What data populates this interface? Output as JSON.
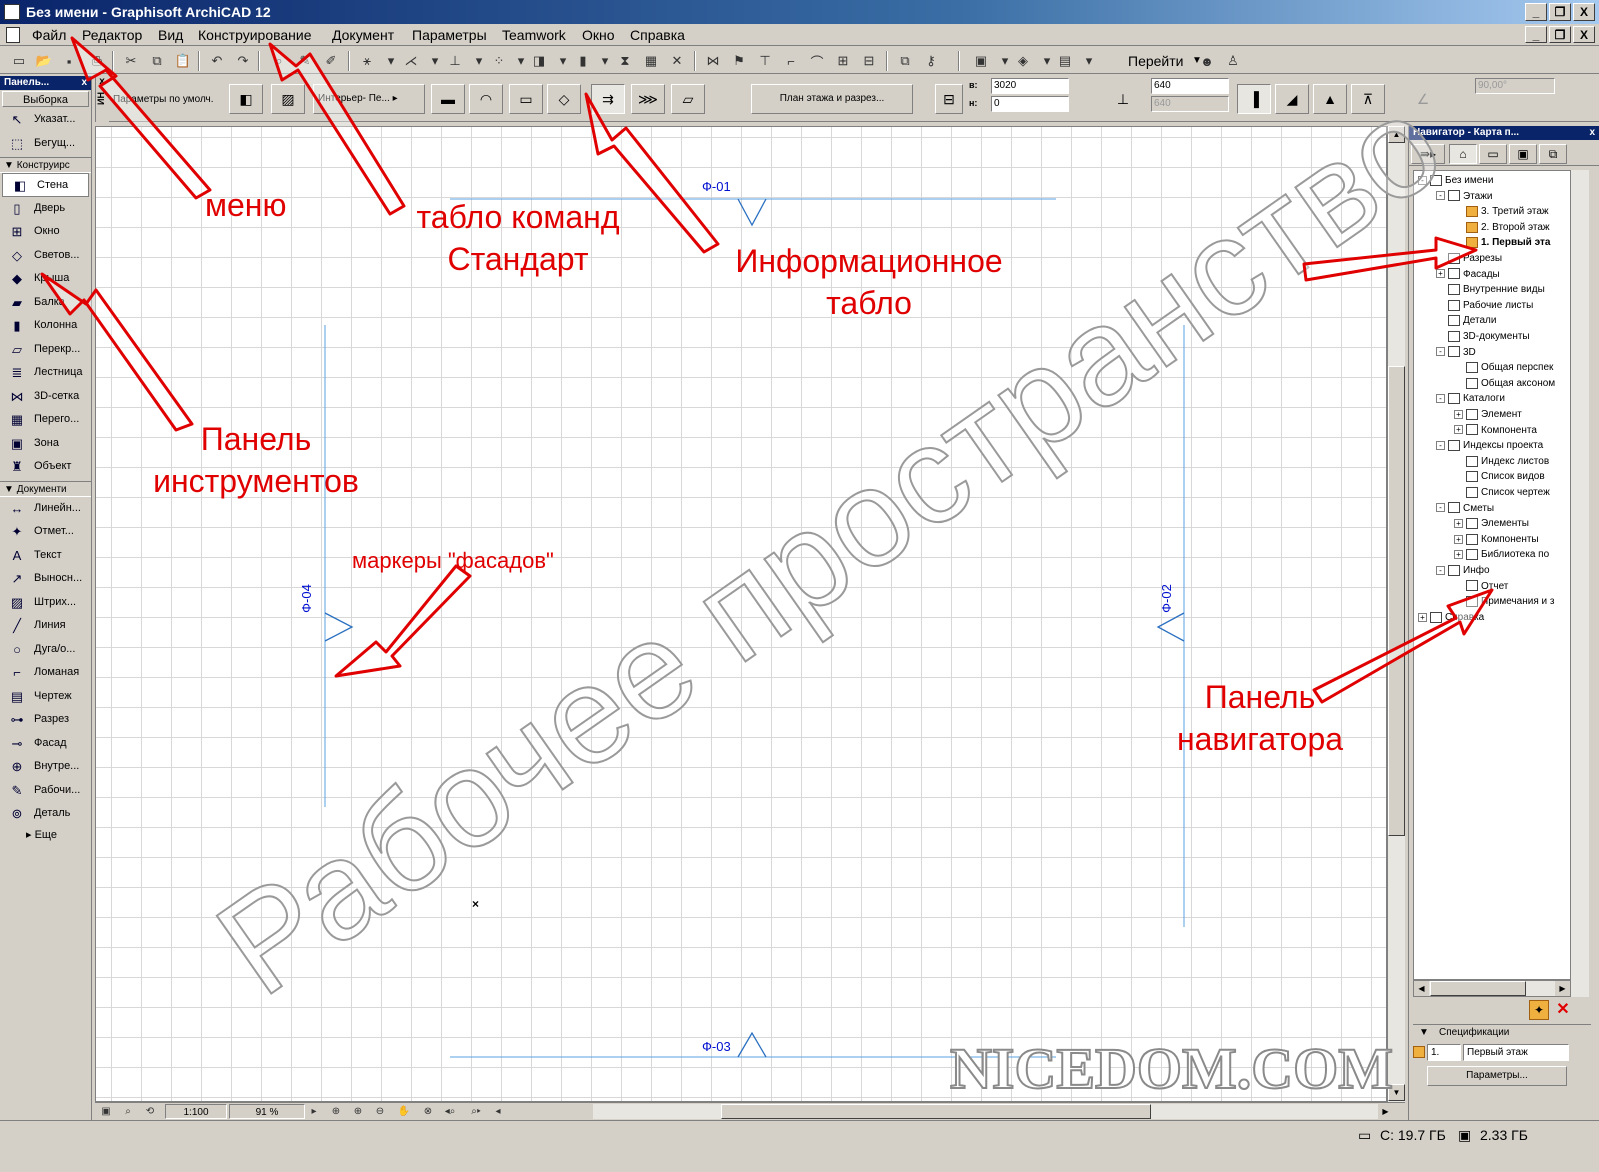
{
  "window": {
    "title": "Без имени - Graphisoft ArchiCAD 12",
    "min": "_",
    "restore": "❐",
    "close": "X"
  },
  "menu": [
    "Файл",
    "Редактор",
    "Вид",
    "Конструирование",
    "Документ",
    "Параметры",
    "Teamwork",
    "Окно",
    "Справка"
  ],
  "toolbar": {
    "goto_label": "Перейти",
    "goto_arrow": "▼"
  },
  "info_box": {
    "vertical_tab": "ИН",
    "close": "x",
    "default_label": "Параметры по умолч.",
    "profile": "Интерьер- Пе...",
    "plan_section": "План этажа и разрез...",
    "top_label": "в:",
    "bottom_label": "н:",
    "top_value": "3020",
    "bottom_value": "0",
    "thickness_value": "640",
    "thickness_value2": "640",
    "angle_value": "90,00°"
  },
  "tool_panel": {
    "title": "Панель...",
    "close": "x",
    "select_label": "Выборка",
    "section_design": "Конструирс",
    "design_items": [
      {
        "label": "Указат...",
        "icon": "arrow-icon"
      },
      {
        "label": "Бегущ...",
        "icon": "marquee-icon"
      }
    ],
    "construct_items": [
      {
        "label": "Стена",
        "icon": "wall-icon"
      },
      {
        "label": "Дверь",
        "icon": "door-icon"
      },
      {
        "label": "Окно",
        "icon": "window-icon"
      },
      {
        "label": "Светов...",
        "icon": "skylight-icon"
      },
      {
        "label": "Крыша",
        "icon": "roof-icon"
      },
      {
        "label": "Балка",
        "icon": "beam-icon"
      },
      {
        "label": "Колонна",
        "icon": "column-icon"
      },
      {
        "label": "Перекр...",
        "icon": "slab-icon"
      },
      {
        "label": "Лестница",
        "icon": "stair-icon"
      },
      {
        "label": "3D-сетка",
        "icon": "mesh-icon"
      },
      {
        "label": "Перего...",
        "icon": "curtain-wall-icon"
      },
      {
        "label": "Зона",
        "icon": "zone-icon"
      },
      {
        "label": "Объект",
        "icon": "object-icon"
      }
    ],
    "section_docs": "Документи",
    "doc_items": [
      {
        "label": "Линейн...",
        "icon": "dimension-icon"
      },
      {
        "label": "Отмет...",
        "icon": "level-dimension-icon"
      },
      {
        "label": "Текст",
        "icon": "text-icon"
      },
      {
        "label": "Выносн...",
        "icon": "label-icon"
      },
      {
        "label": "Штрих...",
        "icon": "fill-icon"
      },
      {
        "label": "Линия",
        "icon": "line-icon"
      },
      {
        "label": "Дуга/о...",
        "icon": "arc-icon"
      },
      {
        "label": "Ломаная",
        "icon": "polyline-icon"
      },
      {
        "label": "Чертеж",
        "icon": "drawing-icon"
      },
      {
        "label": "Разрез",
        "icon": "section-icon"
      },
      {
        "label": "Фасад",
        "icon": "elevation-icon"
      },
      {
        "label": "Внутре...",
        "icon": "interior-elevation-icon"
      },
      {
        "label": "Рабочи...",
        "icon": "worksheet-icon"
      },
      {
        "label": "Деталь",
        "icon": "detail-icon"
      }
    ],
    "more": "Еще"
  },
  "canvas": {
    "markers": {
      "top": "Ф-01",
      "bottom": "Ф-03",
      "left": "Ф-04",
      "right": "Ф-02"
    },
    "watermark": "Рабочее пространство",
    "site_watermark": "NICEDOM.COM",
    "origin": "×"
  },
  "bottom_bar": {
    "scale": "1:100",
    "zoom": "91 %"
  },
  "navigator": {
    "title": "Навигатор - Карта п...",
    "close": "x",
    "tree": [
      {
        "label": "Без имени",
        "level": 0,
        "toggle": "-"
      },
      {
        "label": "Этажи",
        "level": 1,
        "toggle": "-"
      },
      {
        "label": "3. Третий этаж",
        "level": 2,
        "toggle": ""
      },
      {
        "label": "2. Второй этаж",
        "level": 2,
        "toggle": ""
      },
      {
        "label": "1. Первый эта",
        "level": 2,
        "toggle": "",
        "bold": true
      },
      {
        "label": "Разрезы",
        "level": 1,
        "toggle": ""
      },
      {
        "label": "Фасады",
        "level": 1,
        "toggle": "+"
      },
      {
        "label": "Внутренние виды",
        "level": 1,
        "toggle": ""
      },
      {
        "label": "Рабочие листы",
        "level": 1,
        "toggle": ""
      },
      {
        "label": "Детали",
        "level": 1,
        "toggle": ""
      },
      {
        "label": "3D-документы",
        "level": 1,
        "toggle": ""
      },
      {
        "label": "3D",
        "level": 1,
        "toggle": "-"
      },
      {
        "label": "Общая перспек",
        "level": 2,
        "toggle": ""
      },
      {
        "label": "Общая аксоном",
        "level": 2,
        "toggle": ""
      },
      {
        "label": "Каталоги",
        "level": 1,
        "toggle": "-"
      },
      {
        "label": "Элемент",
        "level": 2,
        "toggle": "+"
      },
      {
        "label": "Компонента",
        "level": 2,
        "toggle": "+"
      },
      {
        "label": "Индексы проекта",
        "level": 1,
        "toggle": "-"
      },
      {
        "label": "Индекс листов",
        "level": 2,
        "toggle": ""
      },
      {
        "label": "Список видов",
        "level": 2,
        "toggle": ""
      },
      {
        "label": "Список чертеж",
        "level": 2,
        "toggle": ""
      },
      {
        "label": "Сметы",
        "level": 1,
        "toggle": "-"
      },
      {
        "label": "Элементы",
        "level": 2,
        "toggle": "+"
      },
      {
        "label": "Компоненты",
        "level": 2,
        "toggle": "+"
      },
      {
        "label": "Библиотека по",
        "level": 2,
        "toggle": "+"
      },
      {
        "label": "Инфо",
        "level": 1,
        "toggle": "-"
      },
      {
        "label": "Отчет",
        "level": 2,
        "toggle": ""
      },
      {
        "label": "Примечания и з",
        "level": 2,
        "toggle": ""
      },
      {
        "label": "Справка",
        "level": 0,
        "toggle": "+"
      }
    ],
    "spec_label": "Спецификации",
    "floor_num": "1.",
    "floor_name": "Первый этаж",
    "params_button": "Параметры..."
  },
  "status": {
    "disk": "С: 19.7 ГБ",
    "ram": "2.33 ГБ"
  },
  "annotations": {
    "menu": "меню",
    "standard_toolbar": "табло команд\nСтандарт",
    "info_box": "Информационное\nтабло",
    "toolbox": "Панель\nинструментов",
    "elevation_markers": "маркеры \"фасадов\"",
    "navigator": "Панель\nнавигатора"
  },
  "colors": {
    "annotation": "#e00000",
    "marker": "#0010d0",
    "titlebar": "#0a246a"
  }
}
